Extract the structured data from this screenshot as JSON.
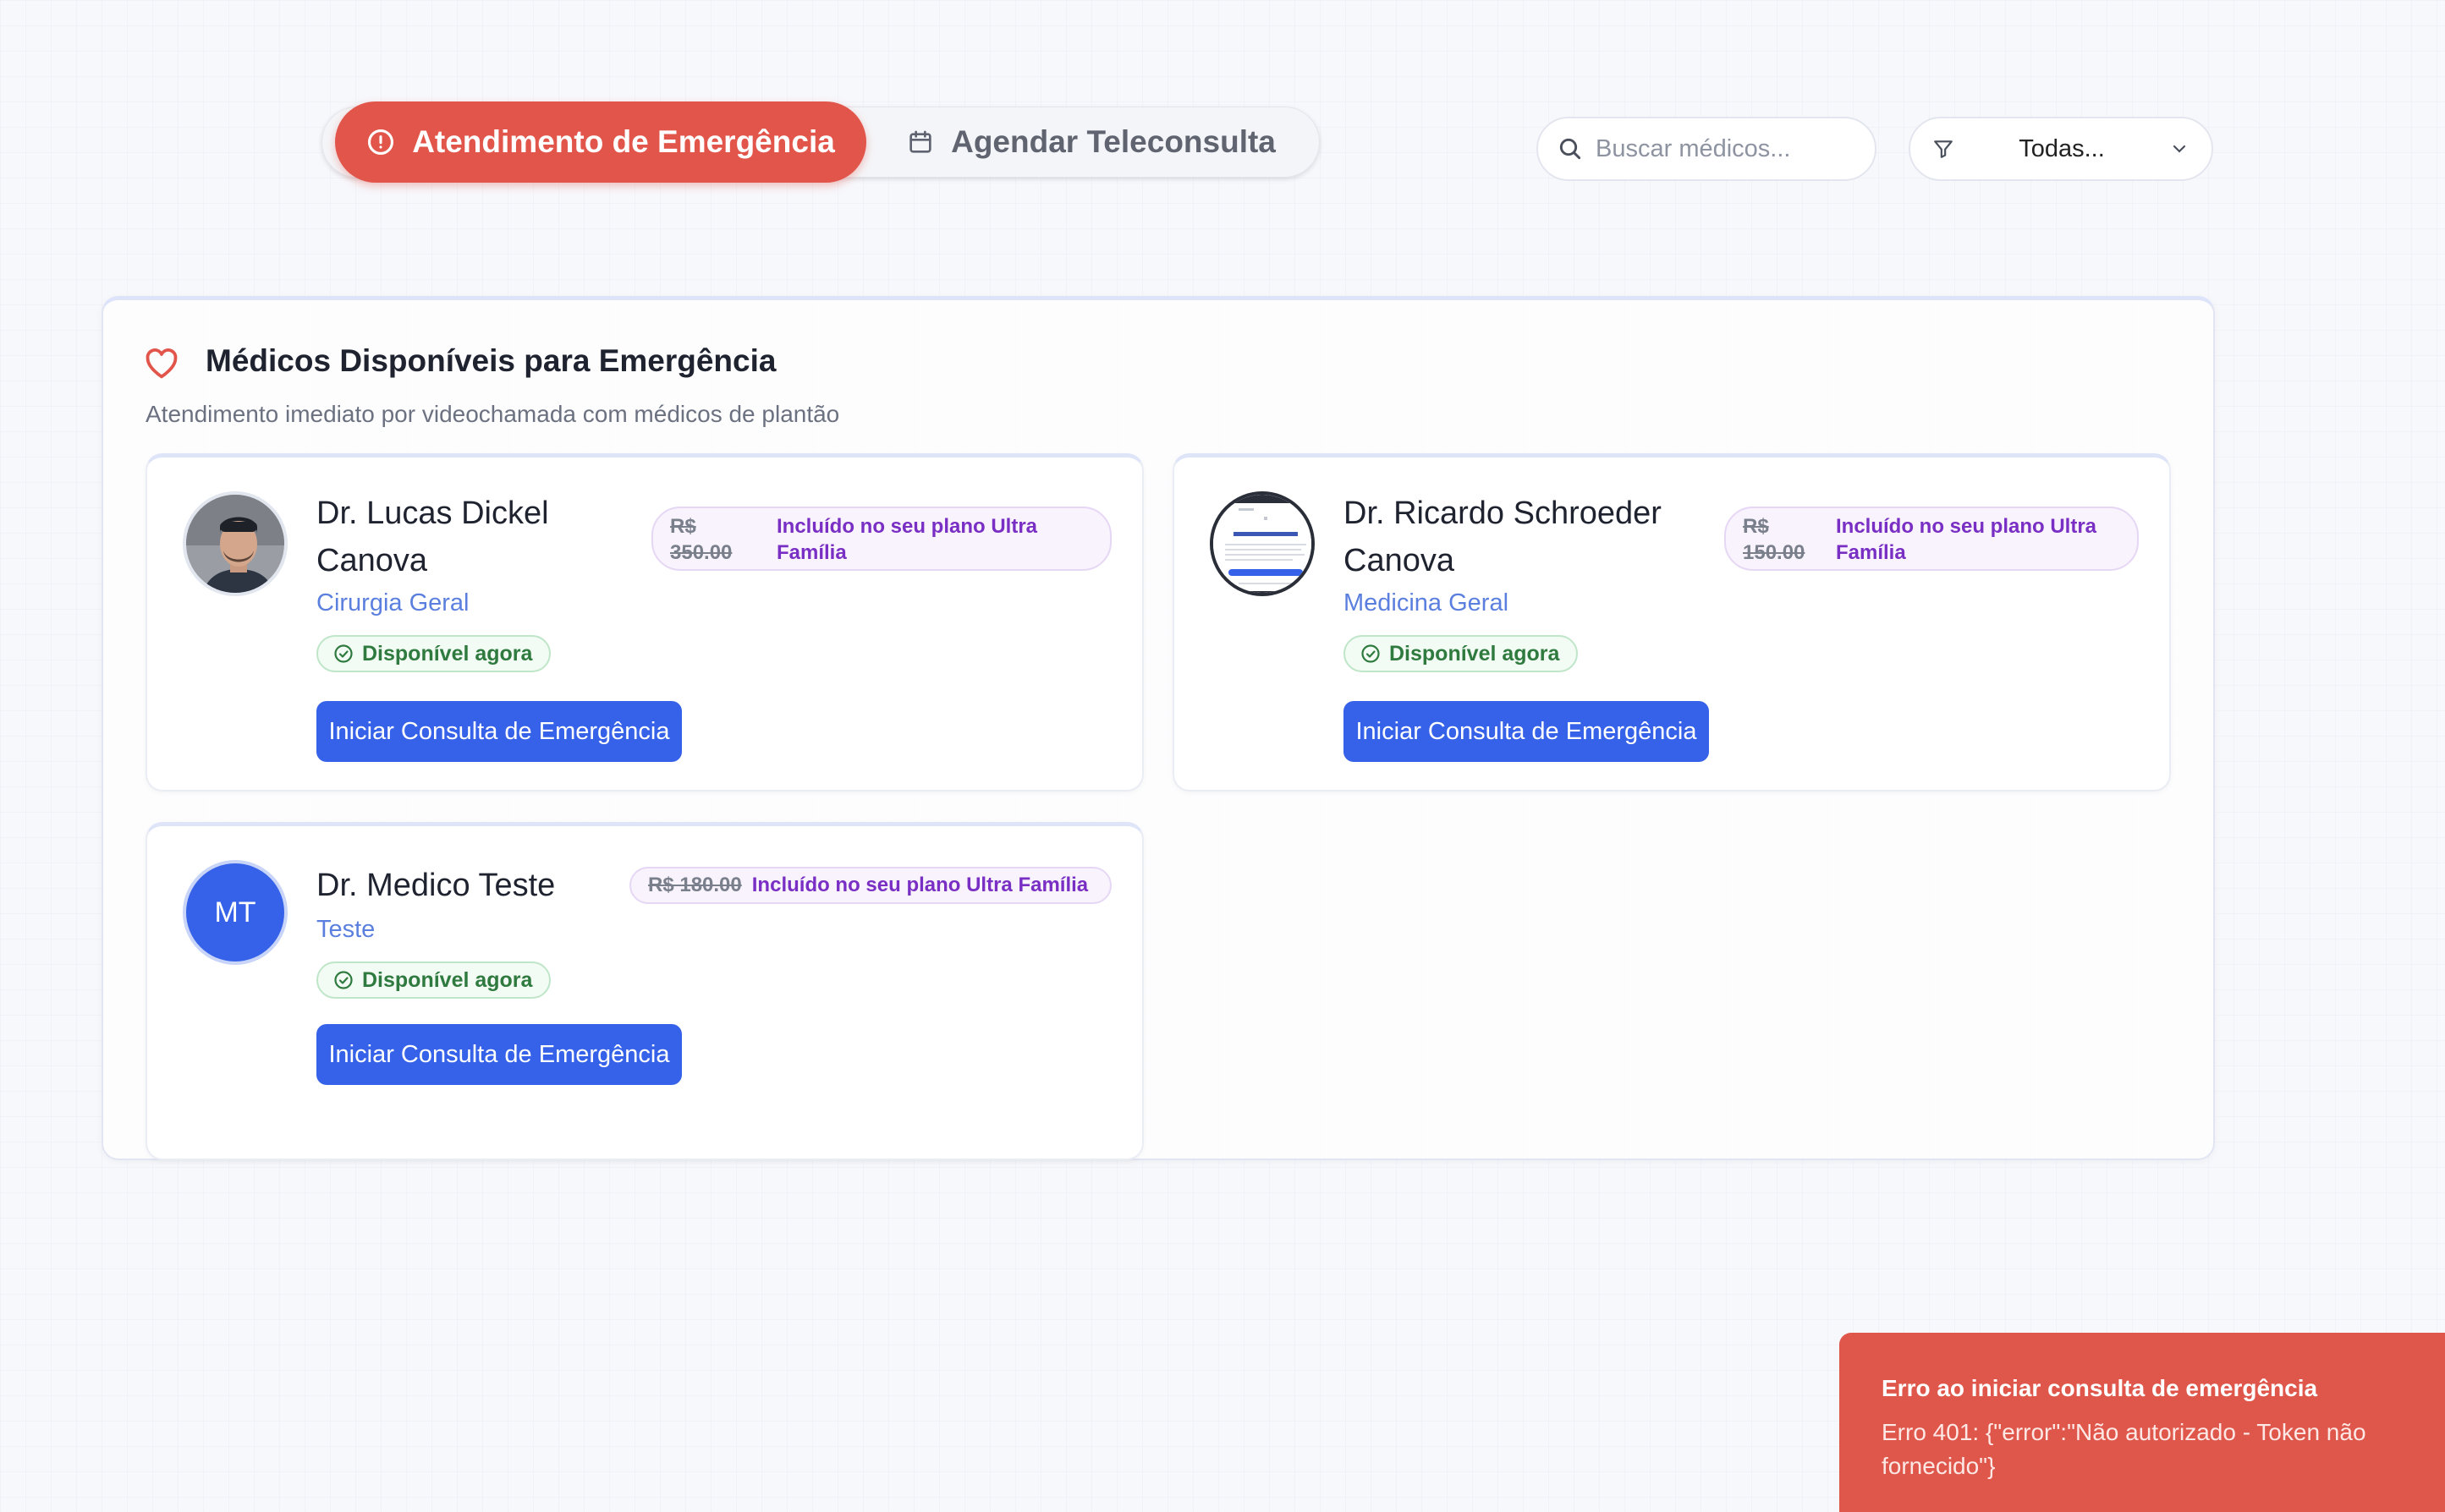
{
  "tabs": {
    "emergency_label": "Atendimento de Emergência",
    "schedule_label": "Agendar Teleconsulta"
  },
  "search": {
    "placeholder": "Buscar médicos..."
  },
  "filter": {
    "value": "Todas..."
  },
  "panel": {
    "title": "Médicos Disponíveis para Emergência",
    "subtitle": "Atendimento imediato por videochamada com médicos de plantão"
  },
  "doctors": [
    {
      "name_line1": "Dr. Lucas Dickel",
      "name_line2": "Canova",
      "specialty": "Cirurgia Geral",
      "status": "Disponível agora",
      "price_line1": "R$",
      "price_line2": "350.00",
      "plan_line1": "Incluído no seu plano Ultra",
      "plan_line2": "Família",
      "button": "Iniciar Consulta de Emergência"
    },
    {
      "name_line1": "Dr. Ricardo Schroeder",
      "name_line2": "Canova",
      "specialty": "Medicina Geral",
      "status": "Disponível agora",
      "price_line1": "R$",
      "price_line2": "150.00",
      "plan_line1": "Incluído no seu plano Ultra",
      "plan_line2": "Família",
      "button": "Iniciar Consulta de Emergência"
    },
    {
      "name": "Dr. Medico Teste",
      "initials": "MT",
      "specialty": "Teste",
      "status": "Disponível agora",
      "price": "R$ 180.00",
      "plan": "Incluído no seu plano Ultra Família",
      "button": "Iniciar Consulta de Emergência"
    }
  ],
  "toast": {
    "title": "Erro ao iniciar consulta de emergência",
    "message": "Erro 401: {\"error\":\"Não autorizado - Token não fornecido\"}"
  },
  "colors": {
    "emergency": "#e2554a",
    "primary": "#3562e8",
    "specialty": "#5b7fde",
    "available": "#2f7a3e",
    "plan": "#7a2fc4",
    "toast": "#df574b"
  },
  "icons": {
    "emergency_tab": "alert-circle-icon",
    "schedule_tab": "calendar-icon",
    "search": "search-icon",
    "filter": "filter-icon",
    "filter_caret": "chevron-down-icon",
    "panel": "heart-icon",
    "status": "check-circle-icon"
  }
}
